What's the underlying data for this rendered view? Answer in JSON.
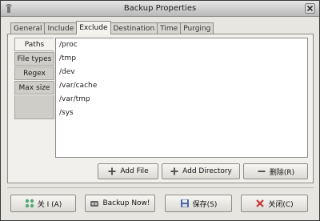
{
  "window": {
    "title": "Backup Properties"
  },
  "tabs": [
    {
      "label": "General",
      "active": false
    },
    {
      "label": "Include",
      "active": false
    },
    {
      "label": "Exclude",
      "active": true
    },
    {
      "label": "Destination",
      "active": false
    },
    {
      "label": "Time",
      "active": false
    },
    {
      "label": "Purging",
      "active": false
    }
  ],
  "sidebar": {
    "items": [
      "Paths",
      "File types",
      "Regex",
      "Max size"
    ]
  },
  "paths": [
    "/proc",
    "/tmp",
    "/dev",
    "/var/cache",
    "/var/tmp",
    "/sys"
  ],
  "panel_buttons": {
    "add_file": "Add File",
    "add_directory": "Add Directory",
    "remove": "删除(R)"
  },
  "footer": {
    "help": "关 I (A)",
    "backup_now": "Backup Now!",
    "save": "保存(S)",
    "close": "关闭(C)"
  },
  "icons": {
    "add": "plus-icon",
    "remove": "minus-icon",
    "help": "help-icon",
    "backup": "backup-icon",
    "save": "save-icon",
    "close": "close-icon"
  }
}
